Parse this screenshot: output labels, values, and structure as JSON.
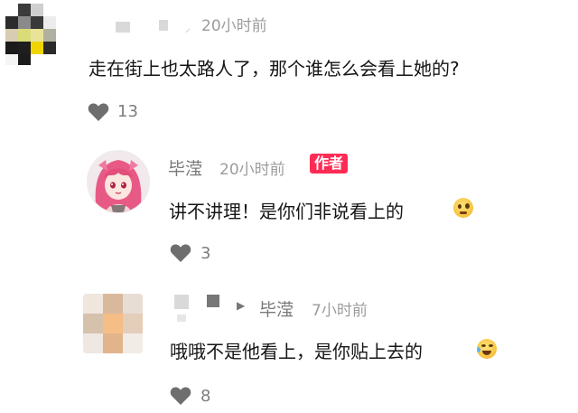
{
  "comments": [
    {
      "time": "20小时前",
      "text": "走在街上也太路人了，那个谁怎么会看上她的?",
      "likes": "13",
      "avatar_icon": "pixelated-avatar"
    },
    {
      "author": "毕滢",
      "time": "20小时前",
      "badge": "作者",
      "text": "讲不讲理！是你们非说看上的",
      "emoji": "woozy-face",
      "likes": "3",
      "avatar_icon": "anime-girl-avatar"
    },
    {
      "reply_to": "毕滢",
      "time": "7小时前",
      "text": "哦哦不是他看上，是你贴上去的",
      "emoji": "laughing-face",
      "likes": "8",
      "avatar_icon": "blurred-avatar"
    }
  ],
  "colors": {
    "badge": "#fe2c55",
    "heart": "#6e6e6e",
    "meta": "#9c9c9c"
  }
}
